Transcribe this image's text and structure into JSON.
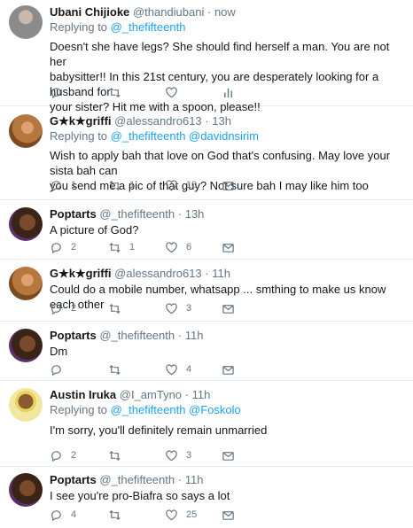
{
  "tweets": [
    {
      "name": "Ubani Chijioke",
      "handle": "@thandiubani",
      "time": "now",
      "replying_prefix": "Replying to",
      "replying_mentions": "@_thefifteenth",
      "text_lines": [
        "Doesn't she have legs? She should find herself a man. You are not her",
        "babysitter!! In this 21st century, you are desperately looking for a husband for",
        "your sister? Hit me with a spoon, please!!"
      ],
      "replies": "",
      "retweets": "",
      "likes": ""
    },
    {
      "name": "G★k★griffi",
      "handle": "@alessandro613",
      "time": "13h",
      "replying_prefix": "Replying to",
      "replying_mentions": "@_thefifteenth @davidnsirim",
      "text_lines": [
        "Wish to apply bah that love on God that's confusing. May love your sista bah can",
        "you send me a pic of that guy? Not sure bah I may like him too"
      ],
      "replies": "1",
      "retweets": "1",
      "likes": "10"
    },
    {
      "name": "Poptarts",
      "handle": "@_thefifteenth",
      "time": "13h",
      "replying_prefix": "",
      "replying_mentions": "",
      "text_lines": [
        "A picture of God?"
      ],
      "replies": "2",
      "retweets": "1",
      "likes": "6"
    },
    {
      "name": "G★k★griffi",
      "handle": "@alessandro613",
      "time": "11h",
      "replying_prefix": "",
      "replying_mentions": "",
      "text_lines": [
        "Could do a mobile number, whatsapp ... smthing to make us know each other"
      ],
      "replies": "2",
      "retweets": "",
      "likes": "3"
    },
    {
      "name": "Poptarts",
      "handle": "@_thefifteenth",
      "time": "11h",
      "replying_prefix": "",
      "replying_mentions": "",
      "text_lines": [
        "Dm"
      ],
      "replies": "",
      "retweets": "",
      "likes": "4"
    },
    {
      "name": "Austin Iruka",
      "handle": "@I_amTyno",
      "time": "11h",
      "replying_prefix": "Replying to",
      "replying_mentions": "@_thefifteenth @Foskolo",
      "text_lines": [
        "I'm sorry, you'll definitely remain unmarried"
      ],
      "replies": "2",
      "retweets": "",
      "likes": "3"
    },
    {
      "name": "Poptarts",
      "handle": "@_thefifteenth",
      "time": "11h",
      "replying_prefix": "",
      "replying_mentions": "",
      "text_lines": [
        "I see you're pro-Biafra so says a lot"
      ],
      "replies": "4",
      "retweets": "",
      "likes": "25"
    }
  ],
  "icons": [
    "reply-icon",
    "retweet-icon",
    "like-icon",
    "dm-icon"
  ],
  "colors": {
    "name": "#14171a",
    "meta": "#657786",
    "link": "#1da1f2",
    "divider": "#e6ecf0"
  }
}
